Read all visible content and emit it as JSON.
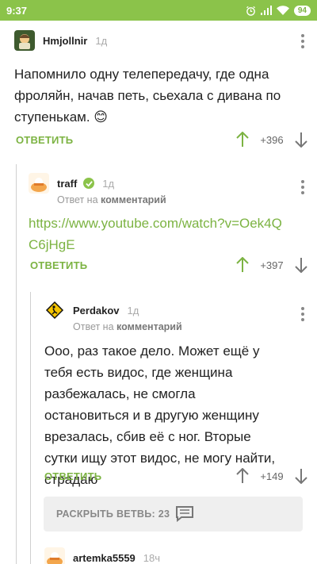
{
  "status": {
    "time": "9:37",
    "battery": "94"
  },
  "comments": [
    {
      "author": "Hmjollnir",
      "time": "1д",
      "text": "Напомнило одну телепередачу, где одна фроляйн, начав петь, сьехала с дивана по ступенькам.",
      "emoji": "😊",
      "reply": "ОТВЕТИТЬ",
      "score": "+396"
    },
    {
      "author": "traff",
      "time": "1д",
      "reply_prefix": "Ответ на",
      "reply_target": "комментарий",
      "link": "https://www.youtube.com/watch?v=Oek4QC6jHgE",
      "reply": "ОТВЕТИТЬ",
      "score": "+397"
    },
    {
      "author": "Perdakov",
      "time": "1д",
      "reply_prefix": "Ответ на",
      "reply_target": "комментарий",
      "text": "Ооо, раз такое дело. Может ещё у тебя есть видос, где женщина разбежалась, не смогла остановиться и в другую женщину врезалась, сбив её с ног. Вторые сутки ищу этот видос, не могу найти, страдаю",
      "reply": "ОТВЕТИТЬ",
      "score": "+149"
    },
    {
      "author": "artemka5559",
      "time": "18ч"
    }
  ],
  "expand": {
    "label": "РАСКРЫТЬ ВЕТВЬ: 23"
  },
  "colors": {
    "accent": "#8bc34a",
    "link": "#7cb342"
  },
  "icons": [
    "alarm-icon",
    "signal-icon",
    "wifi-icon",
    "verified-icon",
    "more-vert-icon",
    "arrow-up-icon",
    "arrow-down-icon",
    "comments-icon"
  ]
}
